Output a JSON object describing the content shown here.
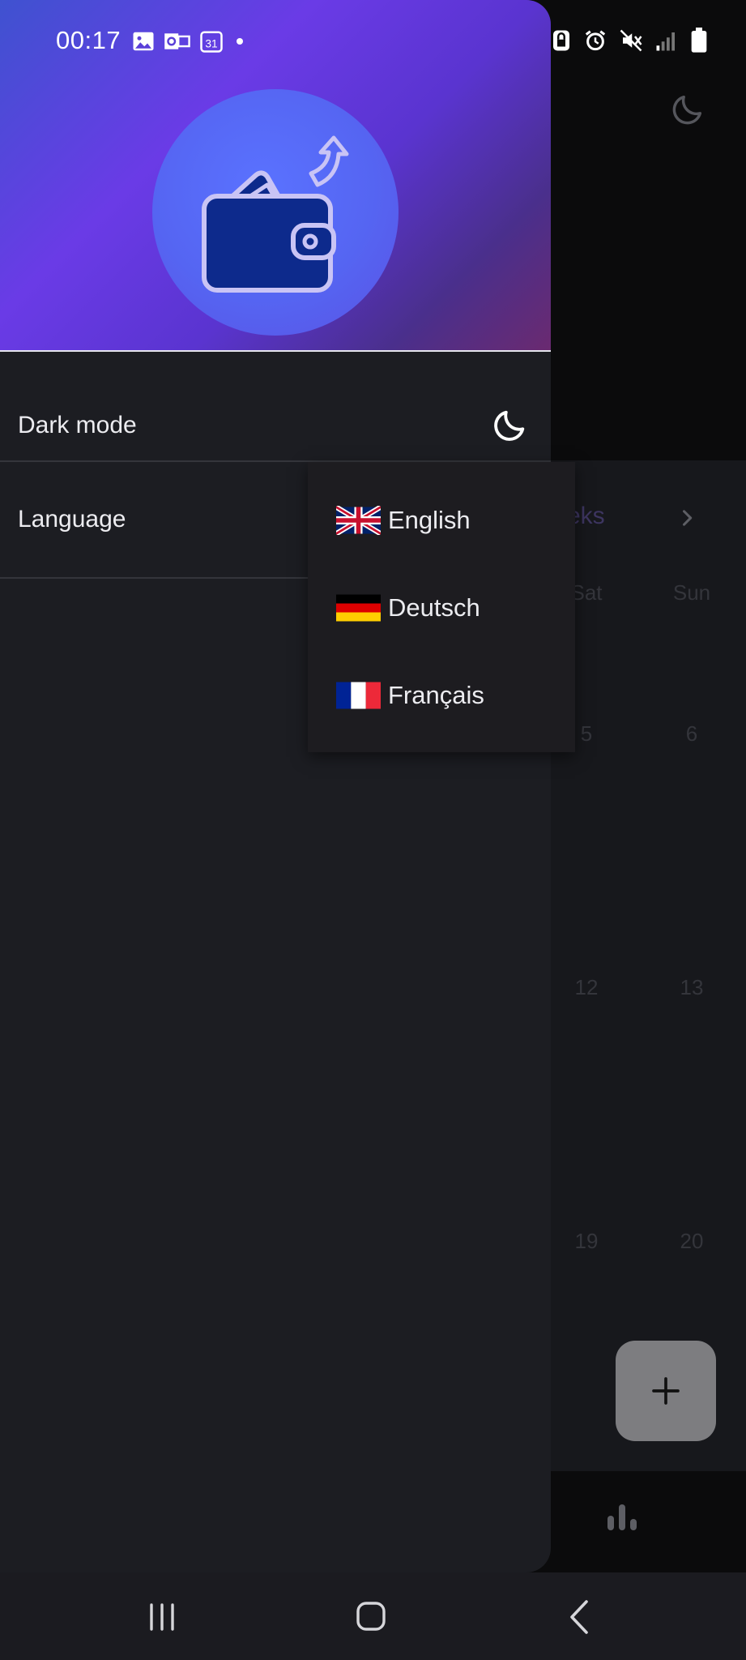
{
  "status_bar": {
    "time": "00:17",
    "left_icons": [
      "gallery-icon",
      "outlook-icon",
      "calendar-31-icon",
      "notification-dot-icon"
    ],
    "right_icons": [
      "vpn-lock-icon",
      "alarm-icon",
      "mute-icon",
      "signal-icon",
      "battery-icon"
    ]
  },
  "drawer": {
    "menu": {
      "dark_mode_label": "Dark mode",
      "language_label": "Language"
    }
  },
  "language_dropdown": {
    "options": [
      {
        "label": "English",
        "flag": "uk-flag-icon"
      },
      {
        "label": "Deutsch",
        "flag": "germany-flag-icon"
      },
      {
        "label": "Français",
        "flag": "france-flag-icon"
      }
    ]
  },
  "background_app": {
    "month_label_partial": "eks",
    "weekdays": [
      "Sat",
      "Sun"
    ],
    "day_numbers": [
      [
        "5",
        "6"
      ],
      [
        "12",
        "13"
      ],
      [
        "19",
        "20"
      ]
    ],
    "fab_symbol": "+"
  },
  "colors": {
    "accent": "#6a3be6",
    "drawer_bg": "#1c1d22",
    "dropdown_bg": "#1d1c20",
    "fab": "#7d7d80"
  }
}
